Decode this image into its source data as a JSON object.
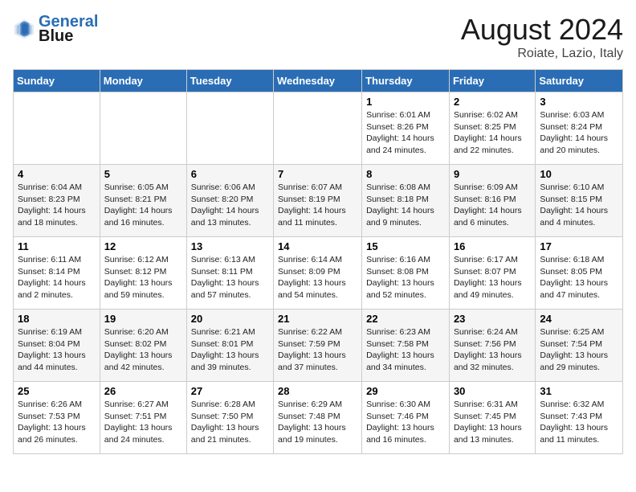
{
  "header": {
    "logo_line1": "General",
    "logo_line2": "Blue",
    "title": "August 2024",
    "subtitle": "Roiate, Lazio, Italy"
  },
  "weekdays": [
    "Sunday",
    "Monday",
    "Tuesday",
    "Wednesday",
    "Thursday",
    "Friday",
    "Saturday"
  ],
  "weeks": [
    [
      {
        "day": "",
        "info": ""
      },
      {
        "day": "",
        "info": ""
      },
      {
        "day": "",
        "info": ""
      },
      {
        "day": "",
        "info": ""
      },
      {
        "day": "1",
        "info": "Sunrise: 6:01 AM\nSunset: 8:26 PM\nDaylight: 14 hours\nand 24 minutes."
      },
      {
        "day": "2",
        "info": "Sunrise: 6:02 AM\nSunset: 8:25 PM\nDaylight: 14 hours\nand 22 minutes."
      },
      {
        "day": "3",
        "info": "Sunrise: 6:03 AM\nSunset: 8:24 PM\nDaylight: 14 hours\nand 20 minutes."
      }
    ],
    [
      {
        "day": "4",
        "info": "Sunrise: 6:04 AM\nSunset: 8:23 PM\nDaylight: 14 hours\nand 18 minutes."
      },
      {
        "day": "5",
        "info": "Sunrise: 6:05 AM\nSunset: 8:21 PM\nDaylight: 14 hours\nand 16 minutes."
      },
      {
        "day": "6",
        "info": "Sunrise: 6:06 AM\nSunset: 8:20 PM\nDaylight: 14 hours\nand 13 minutes."
      },
      {
        "day": "7",
        "info": "Sunrise: 6:07 AM\nSunset: 8:19 PM\nDaylight: 14 hours\nand 11 minutes."
      },
      {
        "day": "8",
        "info": "Sunrise: 6:08 AM\nSunset: 8:18 PM\nDaylight: 14 hours\nand 9 minutes."
      },
      {
        "day": "9",
        "info": "Sunrise: 6:09 AM\nSunset: 8:16 PM\nDaylight: 14 hours\nand 6 minutes."
      },
      {
        "day": "10",
        "info": "Sunrise: 6:10 AM\nSunset: 8:15 PM\nDaylight: 14 hours\nand 4 minutes."
      }
    ],
    [
      {
        "day": "11",
        "info": "Sunrise: 6:11 AM\nSunset: 8:14 PM\nDaylight: 14 hours\nand 2 minutes."
      },
      {
        "day": "12",
        "info": "Sunrise: 6:12 AM\nSunset: 8:12 PM\nDaylight: 13 hours\nand 59 minutes."
      },
      {
        "day": "13",
        "info": "Sunrise: 6:13 AM\nSunset: 8:11 PM\nDaylight: 13 hours\nand 57 minutes."
      },
      {
        "day": "14",
        "info": "Sunrise: 6:14 AM\nSunset: 8:09 PM\nDaylight: 13 hours\nand 54 minutes."
      },
      {
        "day": "15",
        "info": "Sunrise: 6:16 AM\nSunset: 8:08 PM\nDaylight: 13 hours\nand 52 minutes."
      },
      {
        "day": "16",
        "info": "Sunrise: 6:17 AM\nSunset: 8:07 PM\nDaylight: 13 hours\nand 49 minutes."
      },
      {
        "day": "17",
        "info": "Sunrise: 6:18 AM\nSunset: 8:05 PM\nDaylight: 13 hours\nand 47 minutes."
      }
    ],
    [
      {
        "day": "18",
        "info": "Sunrise: 6:19 AM\nSunset: 8:04 PM\nDaylight: 13 hours\nand 44 minutes."
      },
      {
        "day": "19",
        "info": "Sunrise: 6:20 AM\nSunset: 8:02 PM\nDaylight: 13 hours\nand 42 minutes."
      },
      {
        "day": "20",
        "info": "Sunrise: 6:21 AM\nSunset: 8:01 PM\nDaylight: 13 hours\nand 39 minutes."
      },
      {
        "day": "21",
        "info": "Sunrise: 6:22 AM\nSunset: 7:59 PM\nDaylight: 13 hours\nand 37 minutes."
      },
      {
        "day": "22",
        "info": "Sunrise: 6:23 AM\nSunset: 7:58 PM\nDaylight: 13 hours\nand 34 minutes."
      },
      {
        "day": "23",
        "info": "Sunrise: 6:24 AM\nSunset: 7:56 PM\nDaylight: 13 hours\nand 32 minutes."
      },
      {
        "day": "24",
        "info": "Sunrise: 6:25 AM\nSunset: 7:54 PM\nDaylight: 13 hours\nand 29 minutes."
      }
    ],
    [
      {
        "day": "25",
        "info": "Sunrise: 6:26 AM\nSunset: 7:53 PM\nDaylight: 13 hours\nand 26 minutes."
      },
      {
        "day": "26",
        "info": "Sunrise: 6:27 AM\nSunset: 7:51 PM\nDaylight: 13 hours\nand 24 minutes."
      },
      {
        "day": "27",
        "info": "Sunrise: 6:28 AM\nSunset: 7:50 PM\nDaylight: 13 hours\nand 21 minutes."
      },
      {
        "day": "28",
        "info": "Sunrise: 6:29 AM\nSunset: 7:48 PM\nDaylight: 13 hours\nand 19 minutes."
      },
      {
        "day": "29",
        "info": "Sunrise: 6:30 AM\nSunset: 7:46 PM\nDaylight: 13 hours\nand 16 minutes."
      },
      {
        "day": "30",
        "info": "Sunrise: 6:31 AM\nSunset: 7:45 PM\nDaylight: 13 hours\nand 13 minutes."
      },
      {
        "day": "31",
        "info": "Sunrise: 6:32 AM\nSunset: 7:43 PM\nDaylight: 13 hours\nand 11 minutes."
      }
    ]
  ]
}
